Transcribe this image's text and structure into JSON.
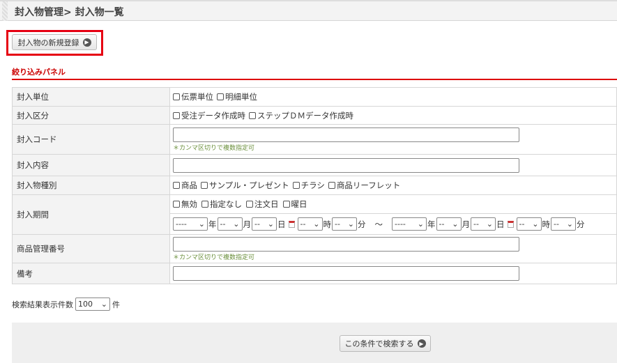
{
  "header": {
    "title": "封入物管理> 封入物一覧"
  },
  "new_button": "封入物の新規登録",
  "panel_title": "絞り込みパネル",
  "rows": {
    "unit": {
      "label": "封入単位",
      "options": [
        "伝票単位",
        "明細単位"
      ]
    },
    "category": {
      "label": "封入区分",
      "options": [
        "受注データ作成時",
        "ステップＤＭデータ作成時"
      ]
    },
    "code": {
      "label": "封入コード",
      "value": "",
      "note": "＊カンマ区切りで複数指定可"
    },
    "content": {
      "label": "封入内容",
      "value": ""
    },
    "type": {
      "label": "封入物種別",
      "options": [
        "商品",
        "サンプル・プレゼント",
        "チラシ",
        "商品リーフレット"
      ]
    },
    "period": {
      "label": "封入期間",
      "options": [
        "無効",
        "指定なし",
        "注文日",
        "曜日"
      ],
      "year": "----",
      "month": "--",
      "day": "--",
      "hour": "--",
      "minute": "--",
      "u_year": "年",
      "u_month": "月",
      "u_day": "日",
      "u_hour": "時",
      "u_minute": "分",
      "tilde": "～"
    },
    "product_no": {
      "label": "商品管理番号",
      "value": "",
      "note": "＊カンマ区切りで複数指定可"
    },
    "remarks": {
      "label": "備考",
      "value": ""
    }
  },
  "count": {
    "label": "検索結果表示件数",
    "value": "100",
    "unit": "件"
  },
  "search_button": "この条件で検索する"
}
